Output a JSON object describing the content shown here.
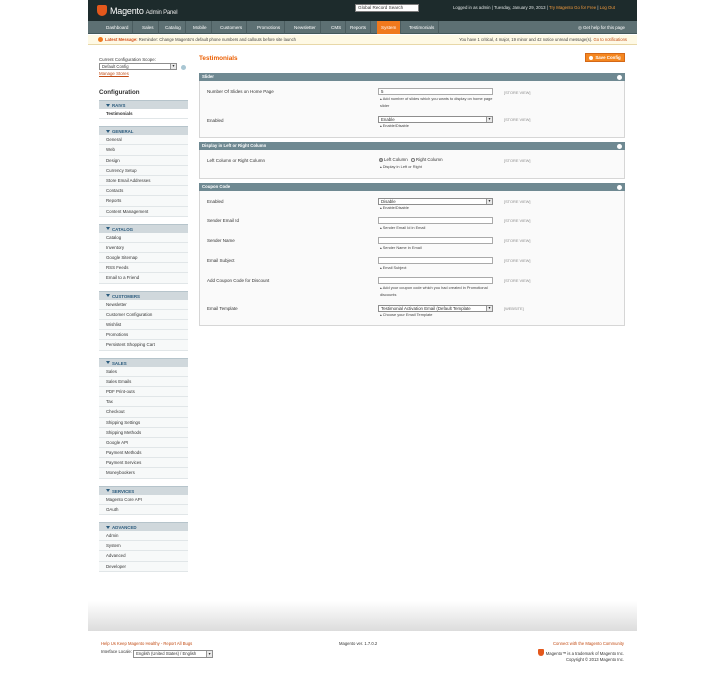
{
  "header": {
    "logo_text": "Magento",
    "logo_sub": "Admin Panel",
    "global_search_placeholder": "Global Record Search",
    "logged_in": "Logged in as admin",
    "date": "Tuesday, January 29, 2013",
    "try_link": "Try Magento Go for Free",
    "logout_link": "Log Out"
  },
  "nav": {
    "items": [
      "Dashboard",
      "Sales",
      "Catalog",
      "Mobile",
      "Customers",
      "Promotions",
      "Newsletter",
      "CMS",
      "Reports",
      "System",
      "Testimonials"
    ],
    "active": "System",
    "help": "Get help for this page"
  },
  "message": {
    "label": "Latest Message:",
    "text": "Reminder: Change Magento's default phone numbers and callouts before site launch",
    "counts": "You have 1 critical, 4 major, 19 minor and 42 notice unread message(s).",
    "link": "Go to notifications"
  },
  "scope": {
    "label": "Current Configuration Scope:",
    "value": "Default Config",
    "manage_link": "Manage Stores"
  },
  "sidebar": {
    "title": "Configuration",
    "groups": [
      {
        "title": "RAIVS",
        "items": [
          "Testimonials"
        ]
      },
      {
        "title": "GENERAL",
        "items": [
          "General",
          "Web",
          "Design",
          "Currency Setup",
          "Store Email Addresses",
          "Contacts",
          "Reports",
          "Content Management"
        ]
      },
      {
        "title": "CATALOG",
        "items": [
          "Catalog",
          "Inventory",
          "Google Sitemap",
          "RSS Feeds",
          "Email to a Friend"
        ]
      },
      {
        "title": "CUSTOMERS",
        "items": [
          "Newsletter",
          "Customer Configuration",
          "Wishlist",
          "Promotions",
          "Persistent Shopping Cart"
        ]
      },
      {
        "title": "SALES",
        "items": [
          "Sales",
          "Sales Emails",
          "PDF Print-outs",
          "Tax",
          "Checkout",
          "Shipping Settings",
          "Shipping Methods",
          "Google API",
          "Payment Methods",
          "Payment Services",
          "Moneybookers"
        ]
      },
      {
        "title": "SERVICES",
        "items": [
          "Magento Core API",
          "OAuth"
        ]
      },
      {
        "title": "ADVANCED",
        "items": [
          "Admin",
          "System",
          "Advanced",
          "Developer"
        ]
      }
    ],
    "active_item": "Testimonials"
  },
  "page": {
    "title": "Testimonials",
    "save_button": "Save Config"
  },
  "sections": {
    "slider": {
      "title": "Slider",
      "slides_label": "Number Of Slides on Home Page",
      "slides_value": "5",
      "slides_note": "Add number of slides which you wants to display on home page slider",
      "slides_scope": "[STORE VIEW]",
      "enabled_label": "Enabled",
      "enabled_value": "Enable",
      "enabled_note": "Enable/Disable",
      "enabled_scope": "[STORE VIEW]"
    },
    "display": {
      "title": "Display in Left or Right Column",
      "col_label": "Left Column or Right Column",
      "opt_left": "Left Column",
      "opt_right": "Right Column",
      "col_note": "Display in Left or Right",
      "col_scope": "[STORE VIEW]"
    },
    "coupon": {
      "title": "Coupon Code",
      "enabled_label": "Enabled",
      "enabled_value": "Disable",
      "enabled_note": "Enable/Disable",
      "enabled_scope": "[STORE VIEW]",
      "sender_email_label": "Sender Email Id",
      "sender_email_value": "",
      "sender_email_note": "Sender Email Id in Email",
      "sender_email_scope": "[STORE VIEW]",
      "sender_name_label": "Sender Name",
      "sender_name_value": "",
      "sender_name_note": "Sender Name in Email",
      "sender_name_scope": "[STORE VIEW]",
      "subject_label": "Email Subject",
      "subject_value": "",
      "subject_note": "Email Subject",
      "subject_scope": "[STORE VIEW]",
      "discount_label": "Add Coupon Code for Discount",
      "discount_value": "",
      "discount_note": "Add your coupon code which you had created in Promotional discounts",
      "discount_scope": "[STORE VIEW]",
      "template_label": "Email Template",
      "template_value": "Testimonial Activation Email (Default Template",
      "template_note": "Choose your Email Template",
      "template_scope": "[WEBSITE]"
    }
  },
  "footer": {
    "help_link": "Help Us Keep Magento Healthy - Report All Bugs",
    "locale_label": "Interface Locale:",
    "locale_value": "English (United States) / English",
    "version": "Magento ver. 1.7.0.2",
    "connect_link": "Connect with the Magento Community",
    "trademark": "Magento™ is a trademark of Magento Inc.",
    "copyright": "Copyright © 2013 Magento Inc."
  },
  "colors": {
    "accent": "#f0791d",
    "header_bg": "#1d2b2c",
    "nav_bg": "#5d7073",
    "section_header": "#6f8992",
    "sidebar_group_bg": "#d0d8dc"
  }
}
